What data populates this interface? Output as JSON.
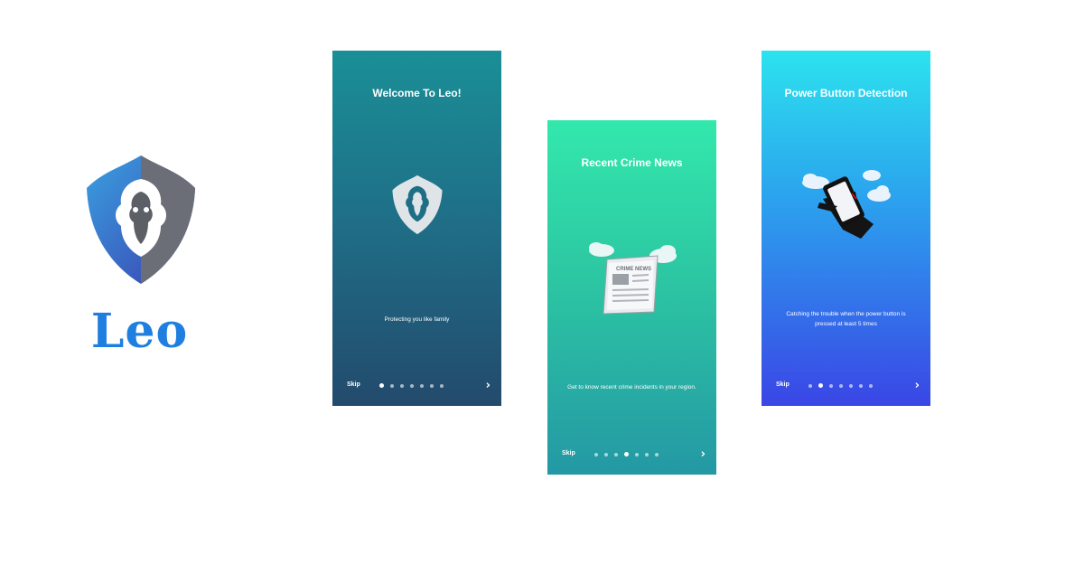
{
  "brand": {
    "name": "Leo",
    "logo_icon": "lion-shield-icon",
    "color": "#1f7fe0"
  },
  "screens": [
    {
      "title": "Welcome To Leo!",
      "description": "Protecting you like family",
      "illustration": "lion-shield-icon",
      "skip_label": "Skip",
      "next_icon": "chevron-right-icon",
      "page_count": 7,
      "active_page": 0
    },
    {
      "title": "Recent Crime News",
      "description": "Get to know recent crime incidents in your region.",
      "illustration": "newspaper-icon",
      "newspaper_headline": "CRIME NEWS",
      "skip_label": "Skip",
      "next_icon": "chevron-right-icon",
      "page_count": 7,
      "active_page": 3
    },
    {
      "title": "Power Button Detection",
      "description": "Catching the trouble when the power button is pressed at least 5 times",
      "illustration": "hand-phone-icon",
      "skip_label": "Skip",
      "next_icon": "chevron-right-icon",
      "page_count": 7,
      "active_page": 1
    }
  ]
}
